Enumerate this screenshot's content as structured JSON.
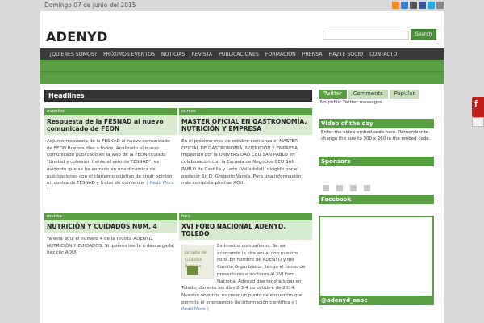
{
  "topbar": {
    "date": "Domingo 07 de junio del 2015"
  },
  "header": {
    "logo": "ADENYD",
    "search_placeholder": "",
    "search_button": "Search"
  },
  "nav": {
    "items": [
      "¿QUIENES SOMOS?",
      "PRÓXIMOS EVENTOS",
      "NOTICIAS",
      "REVISTA",
      "PUBLICACIONES",
      "FORMACIÓN",
      "PRENSA",
      "HAZTE SOCIO",
      "CONTACTO"
    ]
  },
  "main": {
    "headlines": "Headlines",
    "posts": [
      {
        "category": "eventos",
        "title": "Respuesta de la FESNAD al nuevo comunicado de FEDN",
        "excerpt": "Adjunto respuesta de la FESNAD al nuevo comunicado de FEDN Buenos días a todos, Analizado el nuevo comunicado publicado en la web de la FEDN titulado \"Unidad y cohesión frente al veto de FESNAD\", es evidente que se ha entrado en una dinámica de publicaciones con el clarísimo objetivo de crear opinión en contra de FESNAD y tratar de convencer",
        "more": "[ Read More ]"
      },
      {
        "category": "cursos",
        "title": "MASTER OFICIAL EN GASTRONOMÍA, NUTRICIÓN Y EMPRESA",
        "excerpt": "En el próximo mes de octubre comienza el MASTER OFICIAL DE GASTRONOMÍA, NUTRICIÓN Y EMPRESA, impartido por la UNIVERSIDAD CEU SAN PABLO en colaboración con la Escuela de Negocios CEU SAN PABLO de Castilla y León (Valladolid), dirigido por el profesor Sr. D. Gregorio Varela. Para una información más completa pinchar AQUI.",
        "more": ""
      },
      {
        "category": "revista",
        "title": "NUTRICIÓN Y CUIDADOS NUM. 4",
        "excerpt": "Ya está aquí el número 4 de la revista ADENYD, NUTRICIÓN Y CUIDADOS. Si quieres leerla o descargarla, haz clic AQUI",
        "more": ""
      },
      {
        "category": "foro",
        "title": "XVI FORO NACIONAL ADENYD. TOLEDO",
        "excerpt": "Estimados compañeros, Se va acercando la cita anual con nuestro Foro. En nombre de ADENYD y del Comité Organizador, tengo el honor de presentaros e invitaros al XVI Foro Nacional Adenyd que tendrá lugar en Toledo, durante los días 2-3-4 de octubre de 2014. Nuestro objetivo, es crear un punto de encuentro que permita el intercambio de información científica y",
        "more": "[ Read More ]",
        "thumb_caption": "Jornadas de Cuidados Nutricion"
      }
    ]
  },
  "sidebar": {
    "tabs": [
      "Twitter",
      "Comments",
      "Popular"
    ],
    "twitter_text": "No public Twitter messages.",
    "video_title": "Video of the day",
    "video_text": "Enter the video embed code here. Remember to change the size to 300 x 260 in the embed code.",
    "sponsors_title": "Sponsors",
    "facebook_title": "Facebook",
    "adenyd_title": "@adenyd_asoc"
  },
  "colors": {
    "accent": "#5a9e43",
    "nav": "#3a3a3a",
    "title_bg": "#d8eacf",
    "link": "#3a7fc1"
  }
}
